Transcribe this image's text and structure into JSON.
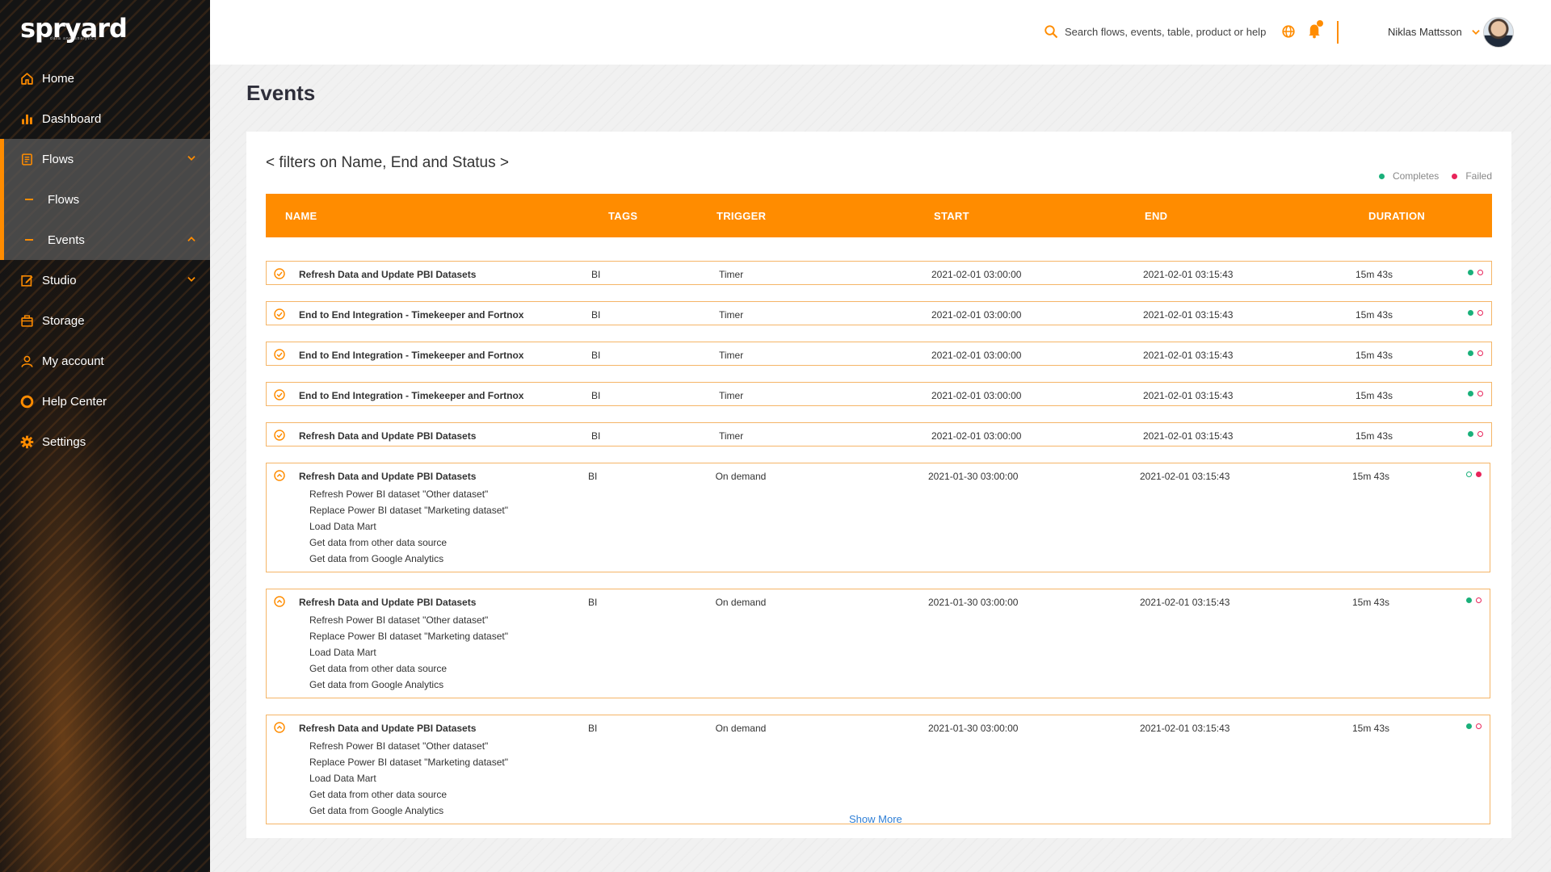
{
  "brand": {
    "name": "spryard",
    "tagline": "data and analytics"
  },
  "sidebar": {
    "items": [
      {
        "label": "Home",
        "icon": "home-icon"
      },
      {
        "label": "Dashboard",
        "icon": "bar-chart-icon"
      },
      {
        "label": "Flows",
        "icon": "flows-icon",
        "expanded": true
      },
      {
        "label": "Flows",
        "icon": "dash",
        "sub": true
      },
      {
        "label": "Events",
        "icon": "dash",
        "sub": true,
        "active": true
      },
      {
        "label": "Studio",
        "icon": "edit-icon"
      },
      {
        "label": "Storage",
        "icon": "storage-icon"
      },
      {
        "label": "My account",
        "icon": "user-icon"
      },
      {
        "label": "Help Center",
        "icon": "help-icon"
      },
      {
        "label": "Settings",
        "icon": "gear-icon"
      }
    ]
  },
  "header": {
    "search_placeholder": "Search flows, events, table, product or help",
    "user_name": "Niklas Mattsson"
  },
  "page": {
    "title": "Events",
    "filters_text": "< filters on Name, End and Status >",
    "legend": {
      "completes": "Completes",
      "failed": "Failed"
    },
    "show_more": "Show More"
  },
  "colors": {
    "accent": "#ff8c00",
    "complete": "#1ab07a",
    "failed": "#e8245a",
    "link": "#2f7fd6"
  },
  "table": {
    "columns": [
      "NAME",
      "TAGS",
      "TRIGGER",
      "START",
      "END",
      "DURATION"
    ],
    "rows": [
      {
        "name": "Refresh Data and Update PBI Datasets",
        "tags": "BI",
        "trigger": "Timer",
        "start": "2021-02-01  03:00:00",
        "end": "2021-02-01  03:15:43",
        "duration": "15m 43s",
        "status": "complete",
        "expanded": false,
        "steps": []
      },
      {
        "name": "End to End Integration - Timekeeper and Fortnox",
        "tags": "BI",
        "trigger": "Timer",
        "start": "2021-02-01  03:00:00",
        "end": "2021-02-01  03:15:43",
        "duration": "15m 43s",
        "status": "complete",
        "expanded": false,
        "steps": []
      },
      {
        "name": "End to End Integration - Timekeeper and Fortnox",
        "tags": "BI",
        "trigger": "Timer",
        "start": "2021-02-01  03:00:00",
        "end": "2021-02-01  03:15:43",
        "duration": "15m 43s",
        "status": "complete",
        "expanded": false,
        "steps": []
      },
      {
        "name": "End to End Integration - Timekeeper and Fortnox",
        "tags": "BI",
        "trigger": "Timer",
        "start": "2021-02-01  03:00:00",
        "end": "2021-02-01  03:15:43",
        "duration": "15m 43s",
        "status": "complete",
        "expanded": false,
        "steps": []
      },
      {
        "name": "Refresh Data and Update PBI Datasets",
        "tags": "BI",
        "trigger": "Timer",
        "start": "2021-02-01  03:00:00",
        "end": "2021-02-01  03:15:43",
        "duration": "15m 43s",
        "status": "complete",
        "expanded": false,
        "steps": []
      },
      {
        "name": "Refresh Data and Update PBI Datasets",
        "tags": "BI",
        "trigger": "On demand",
        "start": "2021-01-30  03:00:00",
        "end": "2021-02-01  03:15:43",
        "duration": "15m 43s",
        "status": "failed",
        "expanded": true,
        "steps": [
          "Refresh Power BI dataset \"Other dataset\"",
          "Replace Power BI dataset \"Marketing dataset\"",
          "Load Data Mart",
          "Get data from other data source",
          "Get data from Google Analytics"
        ]
      },
      {
        "name": "Refresh Data and Update PBI Datasets",
        "tags": "BI",
        "trigger": "On demand",
        "start": "2021-01-30  03:00:00",
        "end": "2021-02-01  03:15:43",
        "duration": "15m 43s",
        "status": "complete",
        "expanded": true,
        "steps": [
          "Refresh Power BI dataset \"Other dataset\"",
          "Replace Power BI dataset \"Marketing dataset\"",
          "Load Data Mart",
          "Get data from other data source",
          "Get data from Google Analytics"
        ]
      },
      {
        "name": "Refresh Data and Update PBI Datasets",
        "tags": "BI",
        "trigger": "On demand",
        "start": "2021-01-30  03:00:00",
        "end": "2021-02-01  03:15:43",
        "duration": "15m 43s",
        "status": "complete",
        "expanded": true,
        "steps": [
          "Refresh Power BI dataset \"Other dataset\"",
          "Replace Power BI dataset \"Marketing dataset\"",
          "Load Data Mart",
          "Get data from other data source",
          "Get data from Google Analytics"
        ]
      }
    ]
  }
}
